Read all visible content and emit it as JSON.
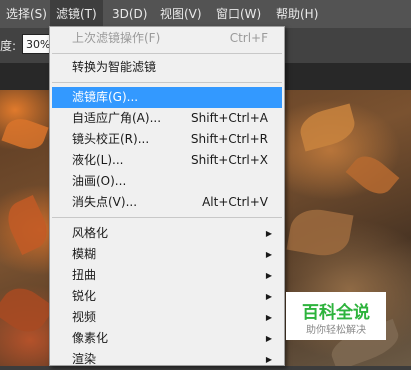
{
  "menubar": {
    "items": [
      {
        "label": "选择(S)"
      },
      {
        "label": "滤镜(T)"
      },
      {
        "label": "3D(D)"
      },
      {
        "label": "视图(V)"
      },
      {
        "label": "窗口(W)"
      },
      {
        "label": "帮助(H)"
      }
    ],
    "active_index": 1
  },
  "options": {
    "label": "度:",
    "value": "30%"
  },
  "filter_menu": {
    "items": [
      {
        "label": "上次滤镜操作(F)",
        "shortcut": "Ctrl+F",
        "disabled": true
      },
      {
        "label": "转换为智能滤镜"
      },
      {
        "label": "滤镜库(G)...",
        "highlighted": true
      },
      {
        "label": "自适应广角(A)...",
        "shortcut": "Shift+Ctrl+A"
      },
      {
        "label": "镜头校正(R)...",
        "shortcut": "Shift+Ctrl+R"
      },
      {
        "label": "液化(L)...",
        "shortcut": "Shift+Ctrl+X"
      },
      {
        "label": "油画(O)..."
      },
      {
        "label": "消失点(V)...",
        "shortcut": "Alt+Ctrl+V"
      },
      {
        "label": "风格化",
        "submenu": true
      },
      {
        "label": "模糊",
        "submenu": true
      },
      {
        "label": "扭曲",
        "submenu": true
      },
      {
        "label": "锐化",
        "submenu": true
      },
      {
        "label": "视频",
        "submenu": true
      },
      {
        "label": "像素化",
        "submenu": true
      },
      {
        "label": "渲染",
        "submenu": true
      }
    ],
    "submenu_arrow": "▶"
  },
  "watermark": {
    "title": "百科全说",
    "subtitle": "助你轻松解决"
  },
  "colors": {
    "menubar_bg": "#535353",
    "menu_bg": "#f0f0f0",
    "highlight": "#3399ff",
    "watermark_green": "#2db33c"
  }
}
